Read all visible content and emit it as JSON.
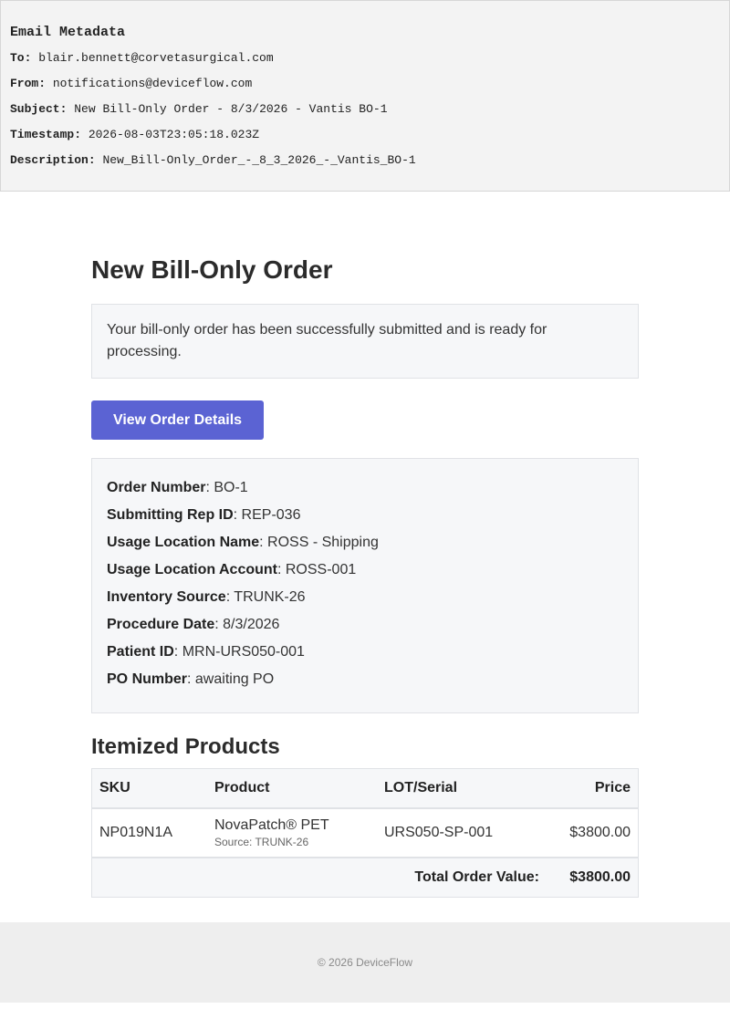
{
  "email_metadata": {
    "heading": "Email Metadata",
    "to_label": "To:",
    "to": "blair.bennett@corvetasurgical.com",
    "from_label": "From:",
    "from": "notifications@deviceflow.com",
    "subject_label": "Subject:",
    "subject": "New Bill-Only Order - 8/3/2026 - Vantis BO-1",
    "timestamp_label": "Timestamp:",
    "timestamp": "2026-08-03T23:05:18.023Z",
    "description_label": "Description:",
    "description": "New_Bill-Only_Order_-_8_3_2026_-_Vantis_BO-1"
  },
  "main": {
    "title": "New Bill-Only Order",
    "notice": "Your bill-only order has been successfully submitted and is ready for processing.",
    "button_label": "View Order Details"
  },
  "details": [
    {
      "label": "Order Number",
      "value": ": BO-1"
    },
    {
      "label": "Submitting Rep ID",
      "value": ": REP-036"
    },
    {
      "label": "Usage Location Name",
      "value": ": ROSS - Shipping"
    },
    {
      "label": "Usage Location Account",
      "value": ": ROSS-001"
    },
    {
      "label": "Inventory Source",
      "value": ": TRUNK-26"
    },
    {
      "label": "Procedure Date",
      "value": ": 8/3/2026"
    },
    {
      "label": "Patient ID",
      "value": ": MRN-URS050-001"
    },
    {
      "label": "PO Number",
      "value": ": awaiting PO"
    }
  ],
  "products": {
    "heading": "Itemized Products",
    "columns": [
      "SKU",
      "Product",
      "LOT/Serial",
      "Price"
    ],
    "rows": [
      {
        "sku": "NP019N1A",
        "product": "NovaPatch® PET",
        "source": "Source: TRUNK-26",
        "lot": "URS050-SP-001",
        "price": "$3800.00"
      }
    ],
    "total_label": "Total Order Value:",
    "total_value": "$3800.00"
  },
  "footer": {
    "text": "© 2026 DeviceFlow"
  },
  "colors": {
    "button": "#5b63d3",
    "panel": "#f6f7f9",
    "metadata_bg": "#f3f3f3",
    "footer_bg": "#eeeeee"
  }
}
